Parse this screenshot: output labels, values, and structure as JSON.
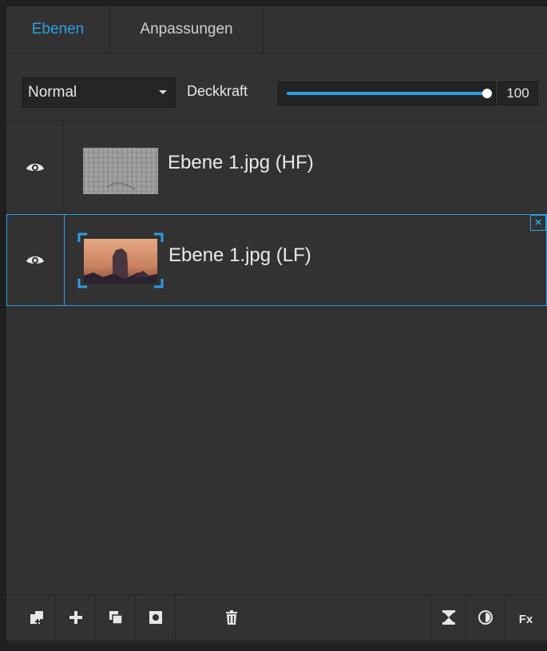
{
  "tabs": [
    {
      "label": "Ebenen",
      "active": true
    },
    {
      "label": "Anpassungen",
      "active": false
    }
  ],
  "blend": {
    "mode": "Normal",
    "opacity_label": "Deckkraft",
    "opacity_value": "100",
    "opacity_fraction": 1.0
  },
  "layers": [
    {
      "name": "Ebene 1.jpg (HF)",
      "visible": true,
      "selected": false
    },
    {
      "name": "Ebene 1.jpg (LF)",
      "visible": true,
      "selected": true
    }
  ],
  "close_glyph": "×",
  "toolbar": {
    "fx_label": "Fx",
    "icons": [
      "new-from-image-icon",
      "add-layer-icon",
      "duplicate-layer-icon",
      "mask-icon",
      "trash-icon",
      "merge-icon",
      "adjustment-icon",
      "fx-icon"
    ]
  },
  "colors": {
    "accent": "#2e9fe6",
    "panel_bg": "#323232"
  }
}
